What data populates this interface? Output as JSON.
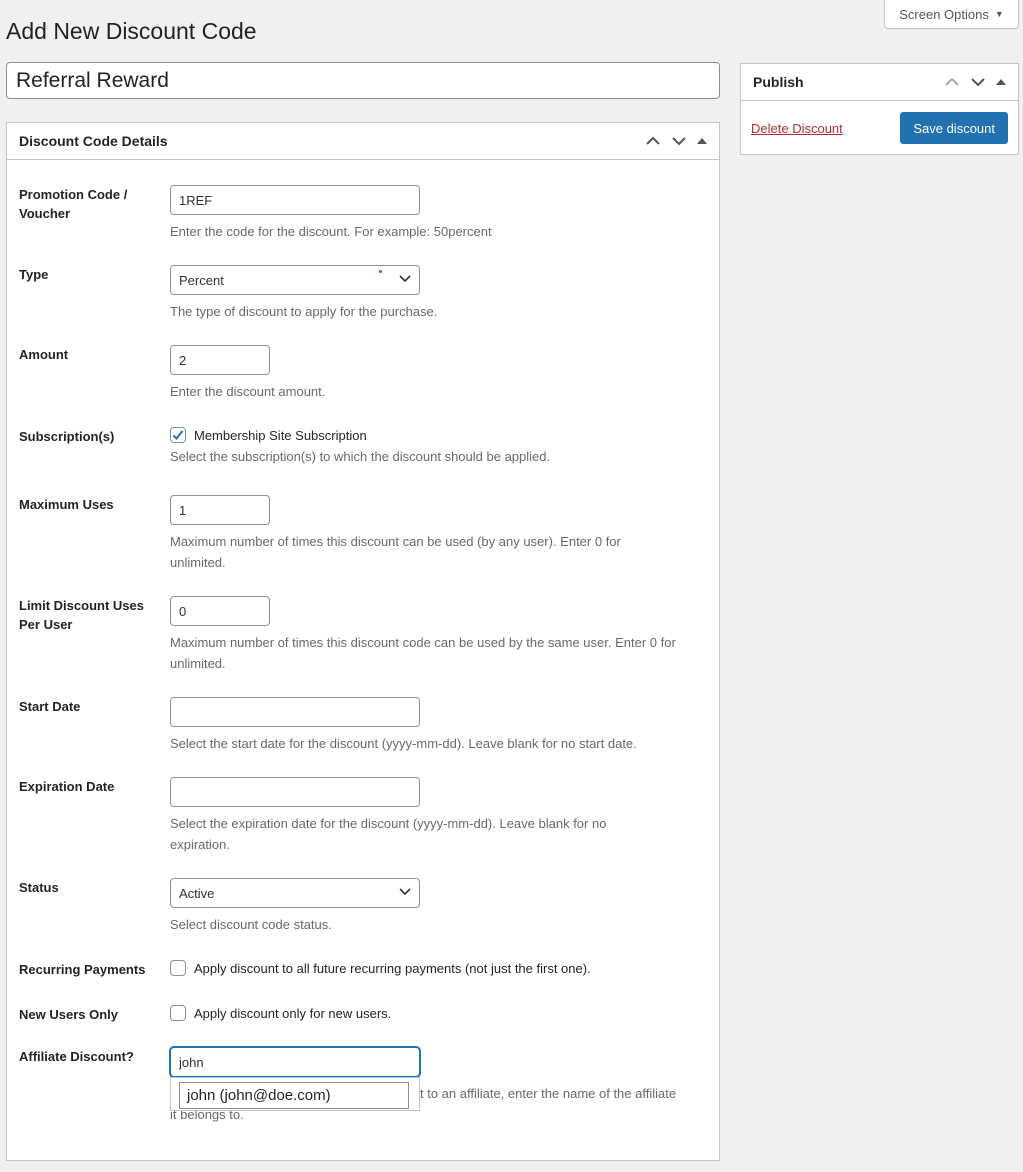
{
  "screen_options": {
    "label": "Screen Options",
    "caret": "▼"
  },
  "page": {
    "title": "Add New Discount Code"
  },
  "title_field": {
    "value": "Referral Reward"
  },
  "publish": {
    "heading": "Publish",
    "delete_label": "Delete Discount",
    "save_label": "Save discount"
  },
  "details": {
    "heading": "Discount Code Details",
    "promo": {
      "label": "Promotion Code / Voucher",
      "value": "1REF",
      "desc": "Enter the code for the discount. For example: 50percent"
    },
    "type": {
      "label": "Type",
      "selected": "Percent",
      "desc": "The type of discount to apply for the purchase."
    },
    "amount": {
      "label": "Amount",
      "value": "2",
      "desc": "Enter the discount amount."
    },
    "subscriptions": {
      "label": "Subscription(s)",
      "option": "Membership Site Subscription",
      "checked": true,
      "desc": "Select the subscription(s) to which the discount should be applied."
    },
    "max_uses": {
      "label": "Maximum Uses",
      "value": "1",
      "desc": "Maximum number of times this discount can be used (by any user). Enter 0 for unlimited."
    },
    "limit_per_user": {
      "label": "Limit Discount Uses Per User",
      "value": "0",
      "desc": "Maximum number of times this discount code can be used by the same user. Enter 0 for unlimited."
    },
    "start_date": {
      "label": "Start Date",
      "value": "",
      "desc": "Select the start date for the discount (yyyy-mm-dd). Leave blank for no start date."
    },
    "expiration_date": {
      "label": "Expiration Date",
      "value": "",
      "desc": "Select the expiration date for the discount (yyyy-mm-dd). Leave blank for no expiration."
    },
    "status": {
      "label": "Status",
      "selected": "Active",
      "desc": "Select discount code status."
    },
    "recurring": {
      "label": "Recurring Payments",
      "text": "Apply discount to all future recurring payments (not just the first one).",
      "checked": false
    },
    "new_users": {
      "label": "New Users Only",
      "text": "Apply discount only for new users.",
      "checked": false
    },
    "affiliate": {
      "label": "Affiliate Discount?",
      "value": "john",
      "suggestion": "john (john@doe.com)",
      "desc_visible": "t to an affiliate, enter the name of the affiliate",
      "desc_visible_2": "it belongs to."
    }
  },
  "colors": {
    "primary": "#2271b1",
    "danger": "#b32d2e",
    "background": "#f0f0f1"
  }
}
